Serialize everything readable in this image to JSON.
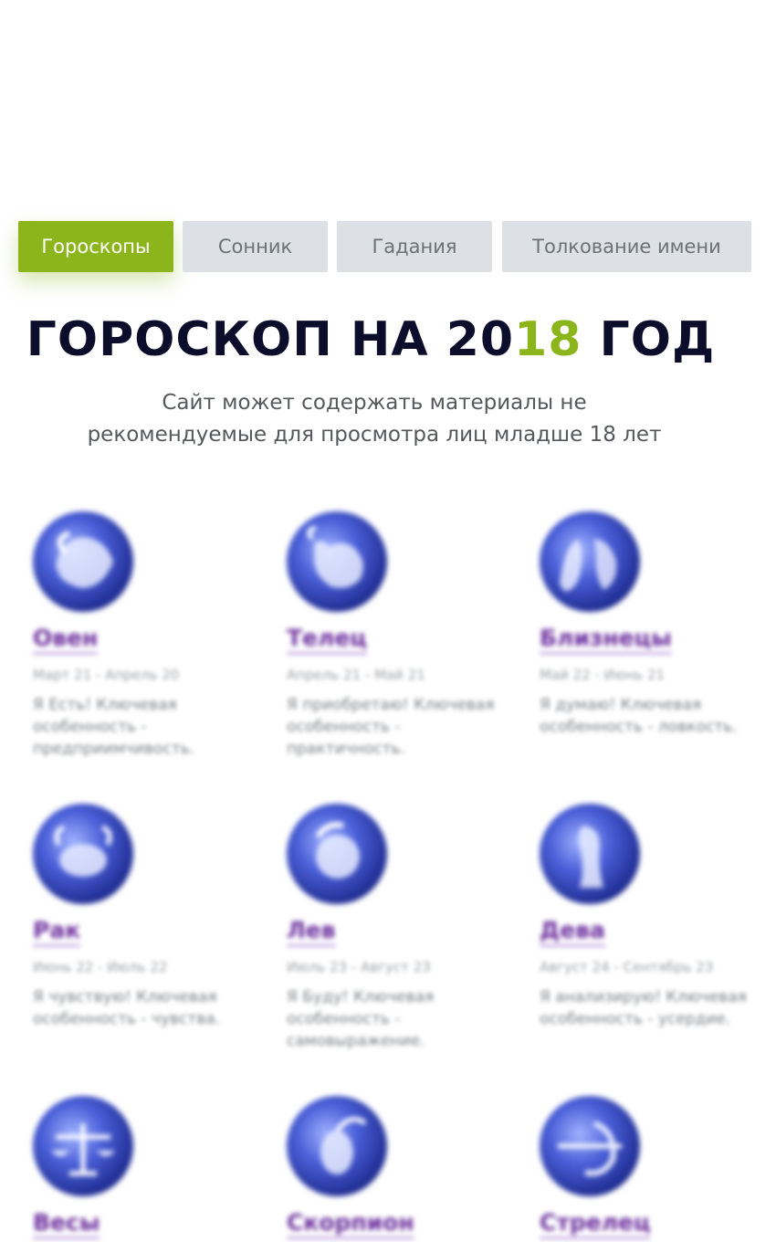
{
  "nav": {
    "tabs": [
      {
        "label": "Гороскопы",
        "active": true
      },
      {
        "label": "Сонник",
        "active": false
      },
      {
        "label": "Гадания",
        "active": false
      },
      {
        "label": "Толкование имени",
        "active": false
      }
    ]
  },
  "header": {
    "title_before": "ГОРОСКОП НА 20",
    "title_accent": "18",
    "title_after": " ГОД",
    "subtitle_line1": "Сайт может содержать материалы не",
    "subtitle_line2": "рекомендуемые для просмотра лиц младше 18 лет"
  },
  "colors": {
    "accent": "#8cb51c",
    "title": "#0c0d2a",
    "sign_link": "#6a2c9c",
    "tab_inactive_bg": "#dde1e5"
  },
  "signs": [
    {
      "name": "Овен",
      "dates": "Март 21 - Апрель 20",
      "desc": "Я Есть! Ключевая особенность - предприимчивость.",
      "icon": "aries-icon"
    },
    {
      "name": "Телец",
      "dates": "Апрель 21 - Май 21",
      "desc": "Я приобретаю! Ключевая особенность - практичность.",
      "icon": "taurus-icon"
    },
    {
      "name": "Близнецы",
      "dates": "Май 22 - Июнь 21",
      "desc": "Я думаю! Ключевая особенность - ловкость.",
      "icon": "gemini-icon"
    },
    {
      "name": "Рак",
      "dates": "Июнь 22 - Июль 22",
      "desc": "Я чувствую! Ключевая особенность - чувства.",
      "icon": "cancer-icon"
    },
    {
      "name": "Лев",
      "dates": "Июль 23 - Август 23",
      "desc": "Я Буду! Ключевая особенность - самовыражение.",
      "icon": "leo-icon"
    },
    {
      "name": "Дева",
      "dates": "Август 24 - Сентябрь 23",
      "desc": "Я анализирую! Ключевая особенность - усердие.",
      "icon": "virgo-icon"
    },
    {
      "name": "Весы",
      "dates": "",
      "desc": "",
      "icon": "libra-icon"
    },
    {
      "name": "Скорпион",
      "dates": "",
      "desc": "",
      "icon": "scorpio-icon"
    },
    {
      "name": "Стрелец",
      "dates": "",
      "desc": "",
      "icon": "sagittarius-icon"
    }
  ]
}
